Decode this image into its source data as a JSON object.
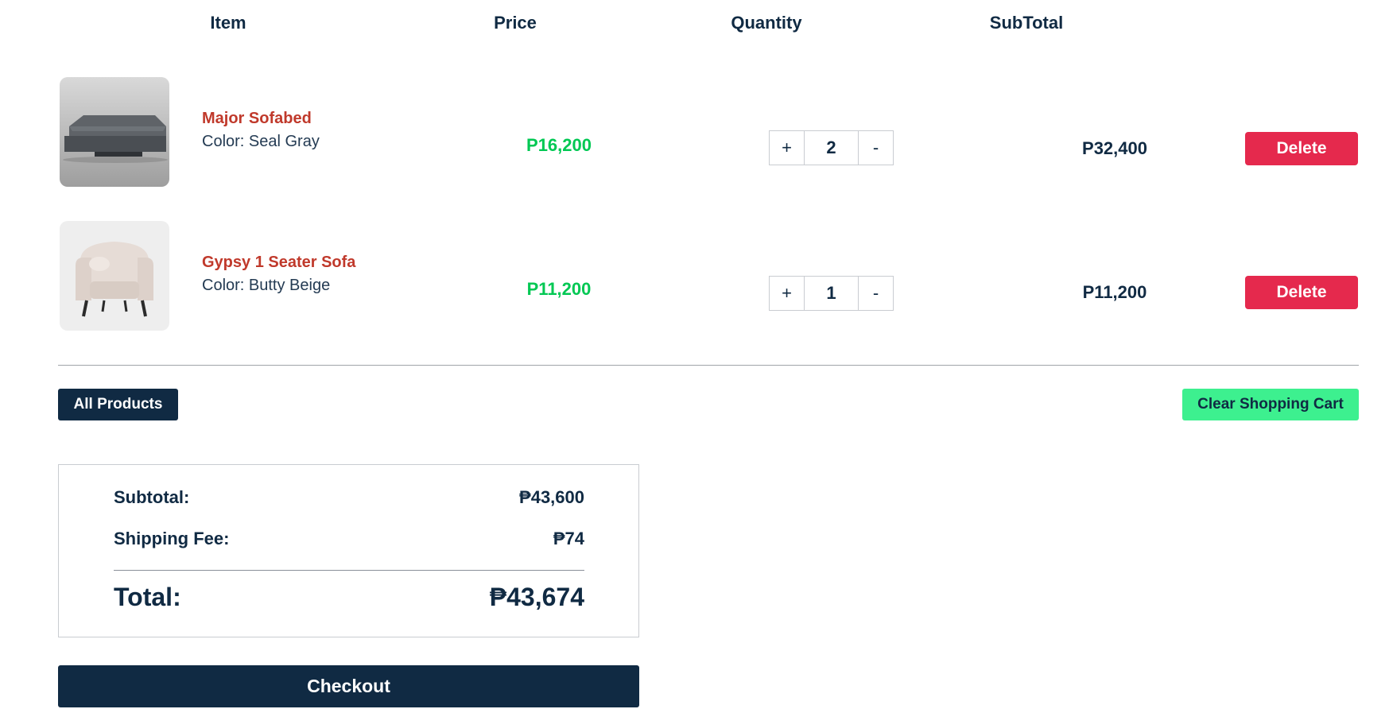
{
  "header": {
    "item": "Item",
    "price": "Price",
    "quantity": "Quantity",
    "subtotal": "SubTotal"
  },
  "cart": {
    "items": [
      {
        "name": "Major Sofabed",
        "color_label": "Color: Seal Gray",
        "price": "P16,200",
        "quantity": "2",
        "subtotal": "P32,400",
        "delete_label": "Delete",
        "plus_label": "+",
        "minus_label": "-",
        "image_icon": "sofabed-image"
      },
      {
        "name": "Gypsy 1 Seater Sofa",
        "color_label": "Color: Butty Beige",
        "price": "P11,200",
        "quantity": "1",
        "subtotal": "P11,200",
        "delete_label": "Delete",
        "plus_label": "+",
        "minus_label": "-",
        "image_icon": "armchair-image"
      }
    ]
  },
  "actions": {
    "all_products": "All Products",
    "clear_cart": "Clear Shopping Cart",
    "checkout": "Checkout"
  },
  "summary": {
    "subtotal_label": "Subtotal:",
    "subtotal_value": "₱43,600",
    "shipping_label": "Shipping Fee:",
    "shipping_value": "₱74",
    "total_label": "Total:",
    "total_value": "₱43,674"
  },
  "colors": {
    "navy": "#102a43",
    "delete_red": "#e5294d",
    "price_green": "#00c853",
    "name_rust": "#c0392b",
    "clear_green": "#3df08f"
  }
}
